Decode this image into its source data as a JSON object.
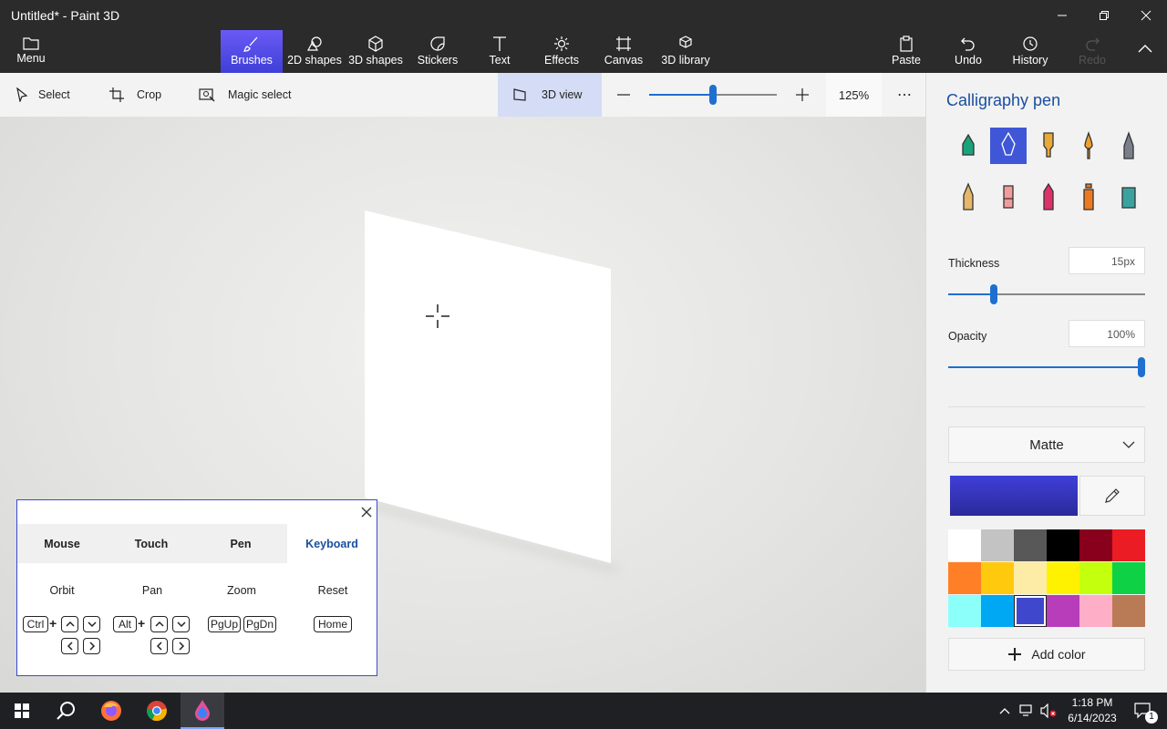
{
  "window": {
    "title": "Untitled* - Paint 3D"
  },
  "ribbon": {
    "menu": "Menu",
    "tabs": [
      {
        "label": "Brushes",
        "icon": "brush-icon",
        "active": true
      },
      {
        "label": "2D shapes",
        "icon": "2d-shapes-icon"
      },
      {
        "label": "3D shapes",
        "icon": "3d-shapes-icon"
      },
      {
        "label": "Stickers",
        "icon": "stickers-icon"
      },
      {
        "label": "Text",
        "icon": "text-icon"
      },
      {
        "label": "Effects",
        "icon": "effects-icon"
      },
      {
        "label": "Canvas",
        "icon": "canvas-icon"
      },
      {
        "label": "3D library",
        "icon": "3d-library-icon"
      }
    ],
    "right": [
      {
        "label": "Paste",
        "icon": "paste-icon"
      },
      {
        "label": "Undo",
        "icon": "undo-icon"
      },
      {
        "label": "History",
        "icon": "history-icon"
      },
      {
        "label": "Redo",
        "icon": "redo-icon",
        "disabled": true
      }
    ]
  },
  "toolbar": {
    "select": "Select",
    "crop": "Crop",
    "magic_select": "Magic select",
    "view3d": "3D view",
    "zoom": "125%",
    "zoom_level": 0.5
  },
  "panel": {
    "title": "Calligraphy pen",
    "brushes": [
      {
        "name": "marker",
        "color": "#1aa37a"
      },
      {
        "name": "calligraphy-pen",
        "color": "#3f56d6",
        "selected": true
      },
      {
        "name": "oil-brush",
        "color": "#e8a93a"
      },
      {
        "name": "watercolor",
        "color": "#f0a030"
      },
      {
        "name": "pixel-pen",
        "color": "#7a7f8c"
      },
      {
        "name": "pencil",
        "color": "#e8b66a"
      },
      {
        "name": "eraser",
        "color": "#f29b9b"
      },
      {
        "name": "crayon",
        "color": "#e0306a"
      },
      {
        "name": "spray-can",
        "color": "#ee7a20"
      },
      {
        "name": "fill",
        "color": "#3aa3a0"
      }
    ],
    "thickness_label": "Thickness",
    "thickness_value": "15px",
    "thickness_level": 0.23,
    "opacity_label": "Opacity",
    "opacity_value": "100%",
    "opacity_level": 1.0,
    "finish": "Matte",
    "current_color": "#3f3fd8",
    "palette": [
      "#ffffff",
      "#c3c3c3",
      "#585858",
      "#000000",
      "#88001b",
      "#ec1c24",
      "#ff7f27",
      "#ffc90e",
      "#fdeca6",
      "#fff200",
      "#c4ff0e",
      "#0ed145",
      "#8cfffb",
      "#00a8f3",
      "#3f48cc",
      "#b83dba",
      "#ffaec8",
      "#b97a56"
    ],
    "selected_swatch": 14,
    "add_color": "Add color"
  },
  "help": {
    "tabs": [
      "Mouse",
      "Touch",
      "Pen",
      "Keyboard"
    ],
    "active_tab": 3,
    "columns": [
      "Orbit",
      "Pan",
      "Zoom",
      "Reset"
    ],
    "keys": {
      "ctrl": "Ctrl",
      "alt": "Alt",
      "pgup": "PgUp",
      "pgdn": "PgDn",
      "home": "Home",
      "plus": "+"
    }
  },
  "taskbar": {
    "time": "1:18 PM",
    "date": "6/14/2023",
    "notifications": "1"
  },
  "colors": {
    "accent": "#3f56d6",
    "ribbon_bg": "#2b2b2b",
    "taskbar_bg": "#1f2023"
  }
}
